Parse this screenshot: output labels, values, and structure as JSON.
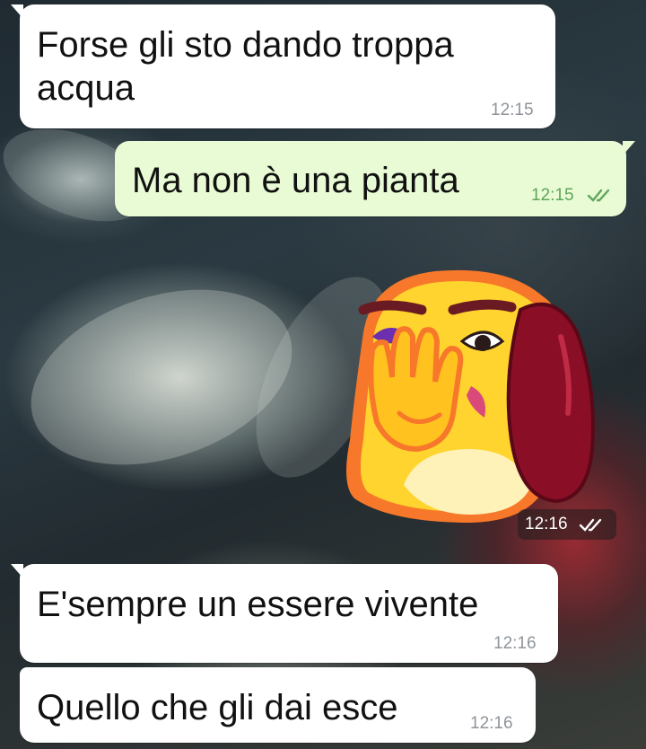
{
  "messages": [
    {
      "id": "m1",
      "direction": "incoming",
      "text_line1": "Forse gli sto dando troppa",
      "text_line2": "acqua",
      "time": "12:15"
    },
    {
      "id": "m2",
      "direction": "outgoing",
      "text": "Ma non è una pianta",
      "time": "12:15",
      "status": "read"
    },
    {
      "id": "m3",
      "direction": "outgoing",
      "type": "sticker",
      "sticker_icon": "facepalm-dog-sticker",
      "time": "12:16",
      "status": "read"
    },
    {
      "id": "m4",
      "direction": "incoming",
      "text": "E'sempre un essere vivente",
      "time": "12:16"
    },
    {
      "id": "m5",
      "direction": "incoming",
      "text": "Quello che gli dai esce",
      "time": "12:16"
    }
  ],
  "colors": {
    "incoming_bubble": "#ffffff",
    "outgoing_bubble": "#e8fbd4",
    "read_ticks": "#5fa55a",
    "timestamp": "#8f9499"
  }
}
